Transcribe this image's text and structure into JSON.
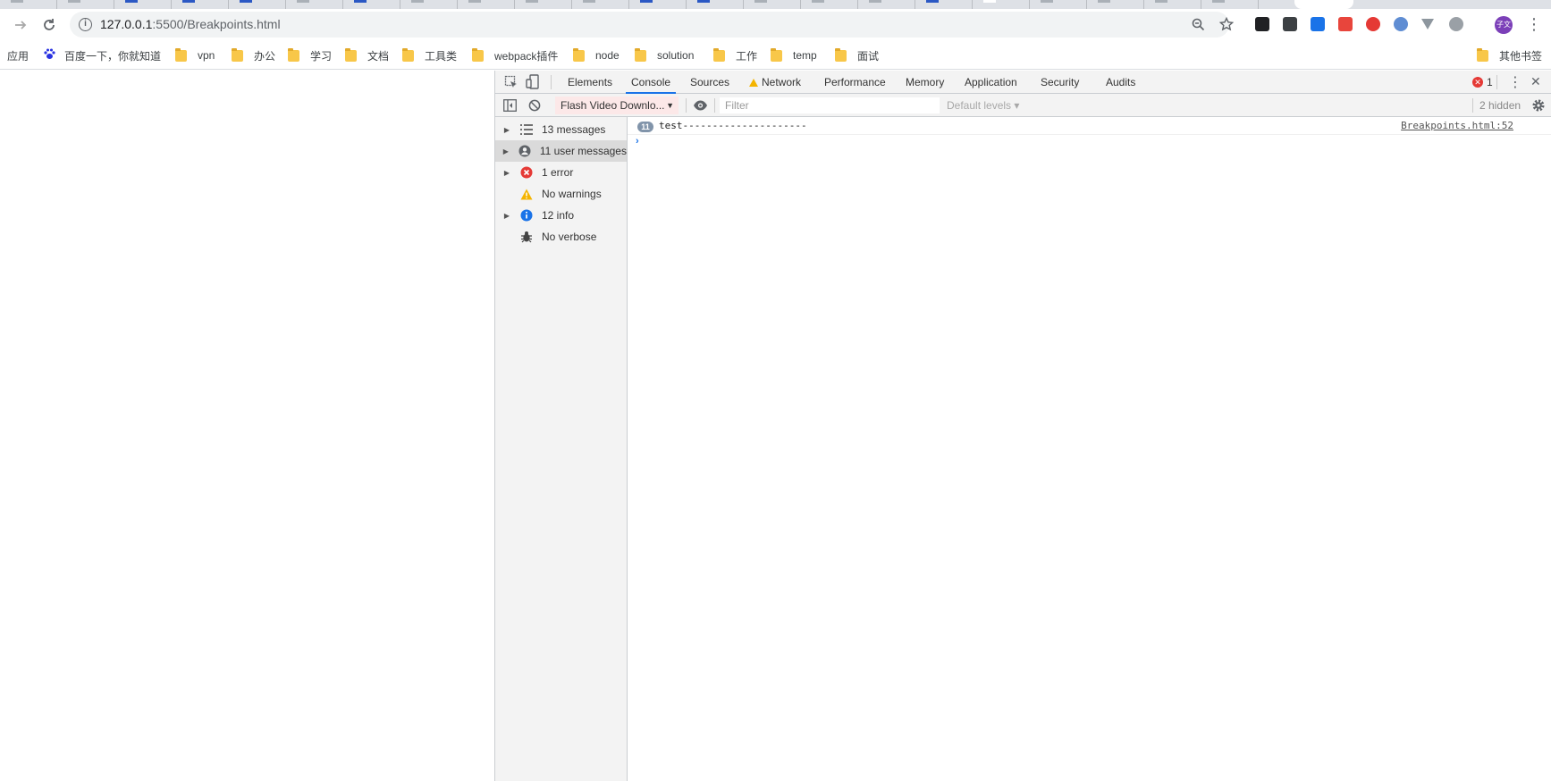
{
  "tab_strip": {
    "tabs": [
      "plain",
      "plain",
      "blue",
      "blue",
      "blue",
      "plain",
      "blue",
      "plain",
      "plain",
      "plain",
      "plain",
      "blue",
      "blue",
      "plain",
      "plain",
      "plain",
      "blue",
      "white",
      "plain",
      "plain",
      "plain",
      "plain"
    ]
  },
  "toolbar": {
    "forward_icon": "forward-arrow-icon",
    "reload_icon": "reload-icon",
    "url_host": "127.0.0.1",
    "url_rest": ":5500/Breakpoints.html",
    "info_icon": "site-info-icon",
    "info_glyph": "i",
    "zoom_icon": "zoom-icon",
    "star_icon": "bookmark-star-icon",
    "menu_glyph": "⋮",
    "profile_label": "子文",
    "extensions": [
      {
        "name": "extension-black-icon",
        "color": "#202124"
      },
      {
        "name": "extension-chart-icon",
        "color": "#3c4043"
      },
      {
        "name": "extension-blue-icon",
        "color": "#1a73e8"
      },
      {
        "name": "extension-sitemap-icon",
        "color": "#e8453c"
      },
      {
        "name": "extension-flash-icon",
        "color": "#e53935"
      },
      {
        "name": "extension-globe-icon",
        "color": "#5f8dd3"
      },
      {
        "name": "extension-vue-icon",
        "color": "#8d969e"
      },
      {
        "name": "extension-grey-circle-icon",
        "color": "#9aa0a6"
      }
    ]
  },
  "bookmarks": {
    "apps_label": "应用",
    "baidu_label": "百度一下，你就知道",
    "folders": [
      "vpn",
      "办公",
      "学习",
      "文档",
      "工具类",
      "webpack插件",
      "node",
      "solution",
      "工作",
      "temp",
      "面试"
    ],
    "other_label": "其他书签"
  },
  "devtools": {
    "tabs": [
      "Elements",
      "Console",
      "Sources",
      "Network",
      "Performance",
      "Memory",
      "Application",
      "Security",
      "Audits"
    ],
    "active_tab": "Console",
    "error_count": "1",
    "close_glyph": "✕",
    "more_glyph": "⋮",
    "console_toolbar": {
      "context": "Flash Video Downlo...",
      "context_arrow": "▼",
      "filter_placeholder": "Filter",
      "levels": "Default levels ▾",
      "hidden": "2 hidden"
    },
    "sidebar": [
      {
        "label": "13 messages",
        "icon": "list-icon",
        "expandable": true,
        "selected": false
      },
      {
        "label": "11 user messages",
        "icon": "user-icon",
        "expandable": true,
        "selected": true
      },
      {
        "label": "1 error",
        "icon": "error-icon",
        "expandable": true,
        "selected": false
      },
      {
        "label": "No warnings",
        "icon": "warning-icon",
        "expandable": false,
        "selected": false
      },
      {
        "label": "12 info",
        "icon": "info-icon",
        "expandable": true,
        "selected": false
      },
      {
        "label": "No verbose",
        "icon": "bug-icon",
        "expandable": false,
        "selected": false
      }
    ],
    "messages": [
      {
        "repeat": "11",
        "text": "test---------------------",
        "source": "Breakpoints.html:52"
      }
    ],
    "prompt_glyph": "›",
    "colors": {
      "accent": "#1a73e8",
      "error": "#e53935",
      "warning": "#f4b400",
      "info": "#1a73e8"
    }
  }
}
